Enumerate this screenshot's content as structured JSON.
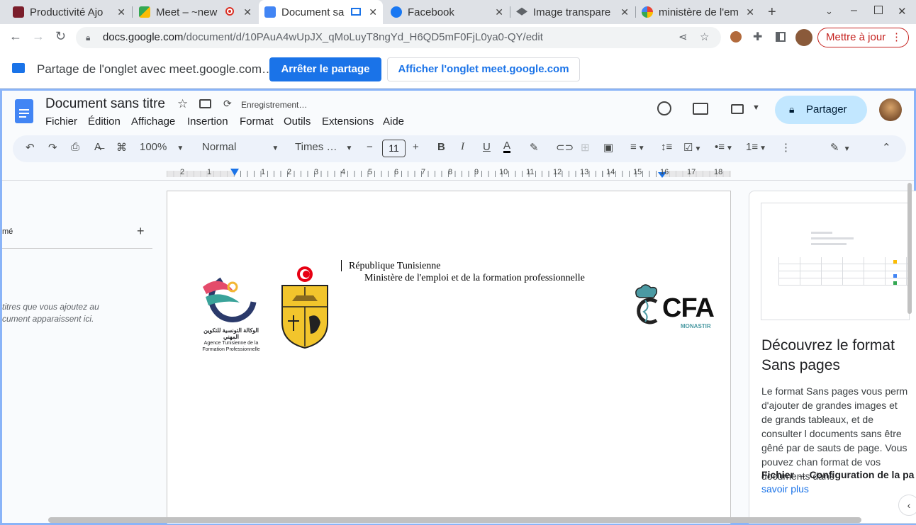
{
  "tabs": [
    {
      "label": "Productivité Ajo",
      "icon": "productivity-icon"
    },
    {
      "label": "Meet – ~new",
      "icon": "meet-icon"
    },
    {
      "label": "Document sa",
      "icon": "docs-icon",
      "active": true
    },
    {
      "label": "Facebook",
      "icon": "facebook-icon"
    },
    {
      "label": "Image transpare",
      "icon": "layers-icon"
    },
    {
      "label": "ministère de l'em",
      "icon": "google-icon"
    }
  ],
  "address": {
    "host": "docs.google.com",
    "path": "/document/d/10PAuA4wUpJX_qMoLuyT8ngYd_H6QD5mF0FjL0ya0-QY/edit",
    "update_label": "Mettre à jour"
  },
  "sharebar": {
    "text": "Partage de l'onglet avec meet.google.com…",
    "stop_label": "Arrêter le partage",
    "show_label": "Afficher l'onglet meet.google.com"
  },
  "doc": {
    "title": "Document sans titre",
    "saving": "Enregistrement…",
    "menus": [
      "Fichier",
      "Édition",
      "Affichage",
      "Insertion",
      "Format",
      "Outils",
      "Extensions",
      "Aide"
    ],
    "share_label": "Partager",
    "zoom": "100%",
    "style": "Normal",
    "font": "Times …",
    "font_size": "11",
    "ruler": [
      "2",
      "1",
      "1",
      "2",
      "3",
      "4",
      "5",
      "6",
      "7",
      "8",
      "9",
      "10",
      "11",
      "12",
      "13",
      "14",
      "15",
      "16",
      "17",
      "18"
    ],
    "header_line1": "République Tunisienne",
    "header_line2": "Ministère de l'emploi et de la formation professionnelle",
    "logo_atfp_ar": "الوكالة التونسية للتكوين المهني",
    "logo_atfp_fr": "Agence Tunisienne de la Formation Professionnelle",
    "logo_cfa": "CFA",
    "logo_cfa_sub": "MONASTIR"
  },
  "outline": {
    "label": "mé",
    "hint": "titres que vous ajoutez au\ncument apparaissent ici."
  },
  "panel": {
    "title": "Découvrez le format Sans pages",
    "body": "Le format Sans pages vous perm d'ajouter de grandes images et de grands tableaux, et de consulter l documents sans être gêné par de sauts de page. Vous pouvez chan format de vos documents dans",
    "menu_path": "Fichier → Configuration de la pa",
    "link": "savoir plus"
  },
  "colors": {
    "accent": "#1a73e8",
    "update": "#c5221f"
  }
}
